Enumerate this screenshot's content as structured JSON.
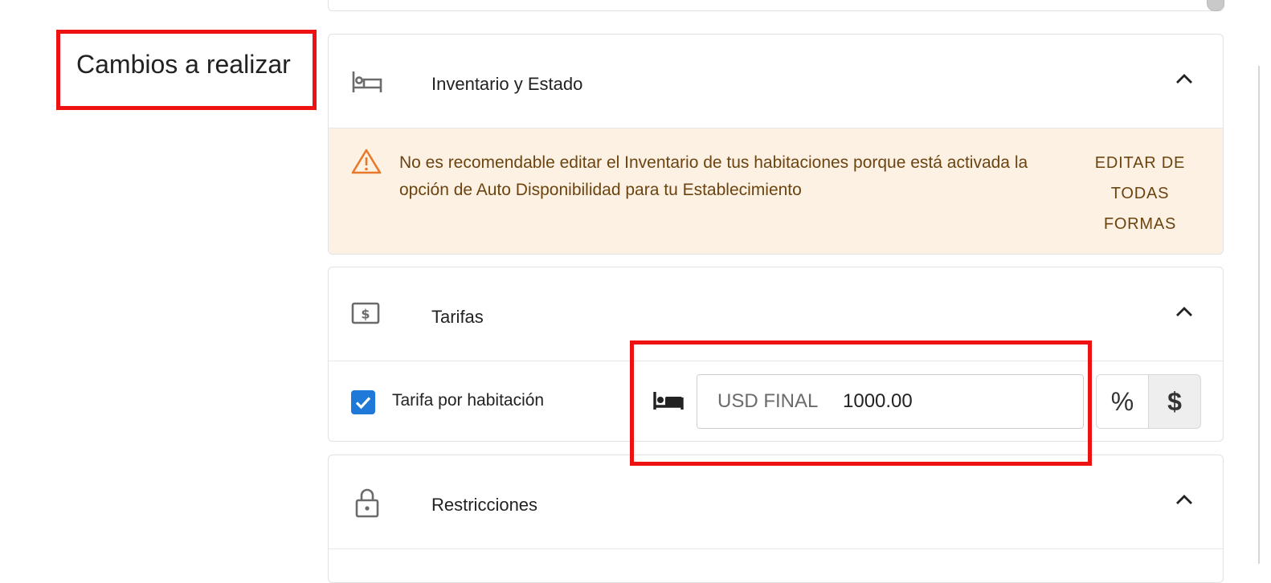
{
  "section": {
    "title": "Cambios a realizar"
  },
  "inventory": {
    "title": "Inventario y Estado",
    "icon": "bed-outline-icon",
    "warning": {
      "icon": "warning-triangle-icon",
      "message": "No es recomendable editar el Inventario de tus habitaciones porque está activada la opción de Auto Disponibilidad para tu Establecimiento",
      "action_lines": [
        "EDITAR DE",
        "TODAS",
        "FORMAS"
      ]
    }
  },
  "rates": {
    "title": "Tarifas",
    "icon": "money-icon",
    "checkbox_label": "Tarifa por habitación",
    "checkbox_checked": true,
    "input_prefix": "USD FINAL",
    "input_value": "1000.00",
    "toggle_percent": "%",
    "toggle_dollar": "$",
    "selected_toggle": "$"
  },
  "restrictions": {
    "title": "Restricciones",
    "icon": "lock-icon"
  },
  "colors": {
    "accent": "#1e79d9",
    "warning_bg": "#fdf1e4",
    "warning_text": "#6b4410",
    "warning_icon": "#e8792b",
    "annotation": "#ee1111"
  }
}
